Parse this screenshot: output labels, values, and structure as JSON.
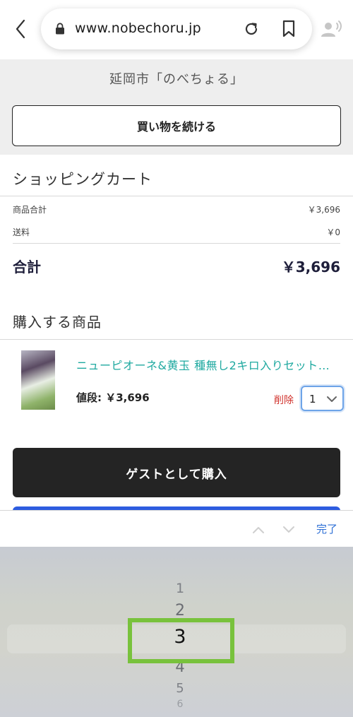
{
  "browser": {
    "url": "www.nobechoru.jp"
  },
  "shop": {
    "store_name": "延岡市「のべちょる」",
    "continue_label": "買い物を続ける"
  },
  "cart": {
    "title": "ショッピングカート",
    "subtotal_label": "商品合計",
    "subtotal_value": "￥3,696",
    "shipping_label": "送料",
    "shipping_value": "￥0",
    "total_label": "合計",
    "total_value": "￥3,696"
  },
  "items": {
    "title": "購入する商品",
    "list": [
      {
        "name": "ニューピオーネ&黄玉 種無し2キロ入りセット（...",
        "price_label": "値段: ￥3,696",
        "delete_label": "削除",
        "quantity": "1"
      }
    ]
  },
  "actions": {
    "guest_purchase_label": "ゲストとして購入"
  },
  "keyboard_toolbar": {
    "done_label": "完了"
  },
  "picker": {
    "options": [
      "1",
      "2",
      "3",
      "4",
      "5",
      "6"
    ],
    "selected": "3"
  },
  "colors": {
    "product_link": "#1fa9a0",
    "delete": "#d0302a",
    "done": "#2c6ed5",
    "highlight_box": "#78c23c",
    "guest_button": "#242424"
  }
}
